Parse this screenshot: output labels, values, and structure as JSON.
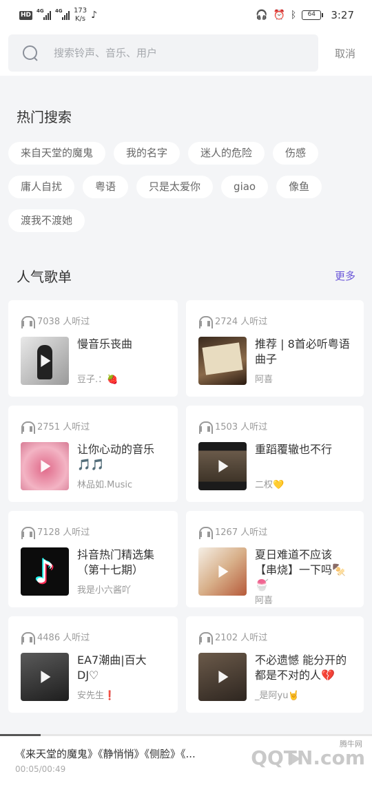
{
  "status": {
    "hd": "HD",
    "net1": "4G",
    "net2": "4G",
    "speed_value": "173",
    "speed_unit": "K/s",
    "battery": "64",
    "time": "3:27"
  },
  "search": {
    "placeholder": "搜索铃声、音乐、用户",
    "cancel_label": "取消"
  },
  "hot_search": {
    "title": "热门搜索",
    "tags": [
      "来自天堂的魔鬼",
      "我的名字",
      "迷人的危险",
      "伤感",
      "庸人自扰",
      "粤语",
      "只是太爱你",
      "giao",
      "像鱼",
      "渡我不渡她"
    ]
  },
  "playlists": {
    "title": "人气歌单",
    "more_label": "更多",
    "items": [
      {
        "listeners": "7038 人听过",
        "title": "慢音乐丧曲",
        "author": "豆子.：🍓",
        "icon": "headphone-icon"
      },
      {
        "listeners": "2724 人听过",
        "title": "推荐 | 8首必听粤语曲子",
        "author": "阿喜",
        "icon": "headphone-icon"
      },
      {
        "listeners": "2751 人听过",
        "title": "让你心动的音乐🎵🎵",
        "author": "林品如.Music",
        "icon": "headphone-icon"
      },
      {
        "listeners": "1503 人听过",
        "title": "重蹈覆辙也不行",
        "author": "二权💛",
        "icon": "headphone-icon"
      },
      {
        "listeners": "7128 人听过",
        "title": "抖音热门精选集（第十七期）",
        "author": "我是小六酱吖",
        "icon": "headphone-icon"
      },
      {
        "listeners": "1267 人听过",
        "title": "夏日难道不应该【串烧】一下吗🍢🍧",
        "author": "阿喜",
        "icon": "headphone-icon"
      },
      {
        "listeners": "4486 人听过",
        "title": "EA7潮曲|百大DJ♡",
        "author": "安先生❗",
        "icon": "headphone-icon"
      },
      {
        "listeners": "2102 人听过",
        "title": "不必遗憾 能分开的都是不对的人💔",
        "author": "_是阿yu🤘",
        "icon": "headphone-icon"
      }
    ]
  },
  "now_playing": {
    "title": "《来天堂的魔鬼》《静悄悄》《侧脸》《...",
    "time": "00:05/00:49",
    "progress": 0.11
  },
  "watermark": {
    "brand": "QQTN.com",
    "small": "腾牛网"
  }
}
